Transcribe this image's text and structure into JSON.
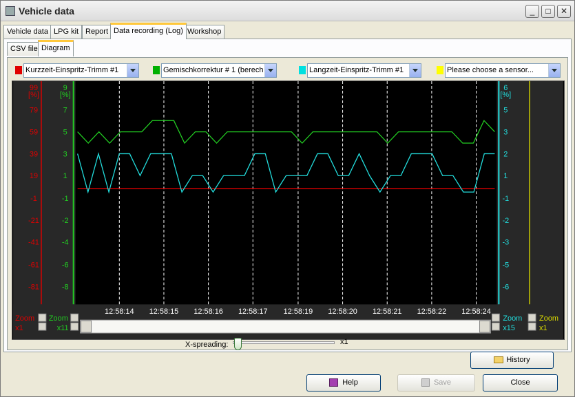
{
  "window": {
    "title": "Vehicle data"
  },
  "title_buttons": {
    "minimize": "_",
    "maximize": "□",
    "close": "✕"
  },
  "tabs": [
    "Vehicle data",
    "LPG kit",
    "Report",
    "Data recording (Log)",
    "Workshop"
  ],
  "subtabs": [
    "CSV file",
    "Diagram"
  ],
  "sensors": [
    {
      "label": "Kurzzeit-Einspritz-Trimm #1",
      "color": "#e00000"
    },
    {
      "label": "Gemischkorrektur # 1 (berech",
      "color": "#00b000"
    },
    {
      "label": "Langzeit-Einspritz-Trimm #1",
      "color": "#00e0e0"
    },
    {
      "label": "Please choose a sensor...",
      "color": "#ffff00"
    }
  ],
  "axes": {
    "red": {
      "unit_top": "99",
      "unit": "[%]",
      "ticks": [
        "79",
        "59",
        "39",
        "19",
        "-1",
        "-21",
        "-41",
        "-61",
        "-81"
      ],
      "color": "#e00000"
    },
    "green": {
      "unit_top": "9",
      "unit": "[%]",
      "ticks": [
        "7",
        "5",
        "3",
        "1",
        "-1",
        "-2",
        "-4",
        "-6",
        "-8"
      ],
      "color": "#22cc22"
    },
    "cyan": {
      "unit_top": "6",
      "unit": "[%]",
      "ticks": [
        "5",
        "3",
        "2",
        "1",
        "-1",
        "-2",
        "-3",
        "-5",
        "-6"
      ],
      "color": "#22dddd"
    }
  },
  "time_labels": [
    "12:58:14",
    "12:58:15",
    "12:58:16",
    "12:58:17",
    "12:58:19",
    "12:58:20",
    "12:58:21",
    "12:58:22",
    "12:58:24"
  ],
  "zoom": {
    "label": "Zoom",
    "red": "x1",
    "green": "x11",
    "cyan": "x15",
    "yellow": "x1"
  },
  "x_spreading": {
    "label": "X-spreading:",
    "value": "x1"
  },
  "buttons": {
    "history": "History",
    "help": "Help",
    "save": "Save",
    "close": "Close"
  },
  "chart_data": {
    "type": "line",
    "x_count": 39,
    "series": [
      {
        "name": "Kurzzeit-Einspritz-Trimm #1",
        "axis": "red",
        "values": [
          0,
          0,
          0,
          0,
          0,
          0,
          0,
          0,
          0,
          0,
          0,
          0,
          0,
          0,
          0,
          0,
          0,
          0,
          0,
          0,
          0,
          0,
          0,
          0,
          0,
          0,
          0,
          0,
          0,
          0,
          0,
          0,
          0,
          0,
          0,
          0,
          0,
          0,
          0
        ]
      },
      {
        "name": "Gemischkorrektur # 1 (berech",
        "axis": "green",
        "values": [
          5,
          4,
          5,
          4,
          5,
          5,
          5,
          6,
          6,
          6,
          4,
          5,
          5,
          4,
          5,
          5,
          5,
          5,
          5,
          5,
          5,
          4,
          5,
          5,
          5,
          5,
          5,
          5,
          5,
          4,
          5,
          5,
          5,
          5,
          5,
          5,
          4,
          4,
          6,
          5
        ]
      },
      {
        "name": "Langzeit-Einspritz-Trimm #1",
        "axis": "cyan",
        "values": [
          2,
          -1,
          2,
          -1,
          2,
          2,
          1,
          2,
          2,
          2,
          -1,
          1,
          1,
          -1,
          1,
          1,
          1,
          2,
          2,
          -1,
          1,
          1,
          1,
          2,
          2,
          1,
          1,
          2,
          1,
          -1,
          1,
          1,
          2,
          2,
          2,
          1,
          1,
          -1,
          -1,
          2,
          2
        ]
      }
    ]
  }
}
